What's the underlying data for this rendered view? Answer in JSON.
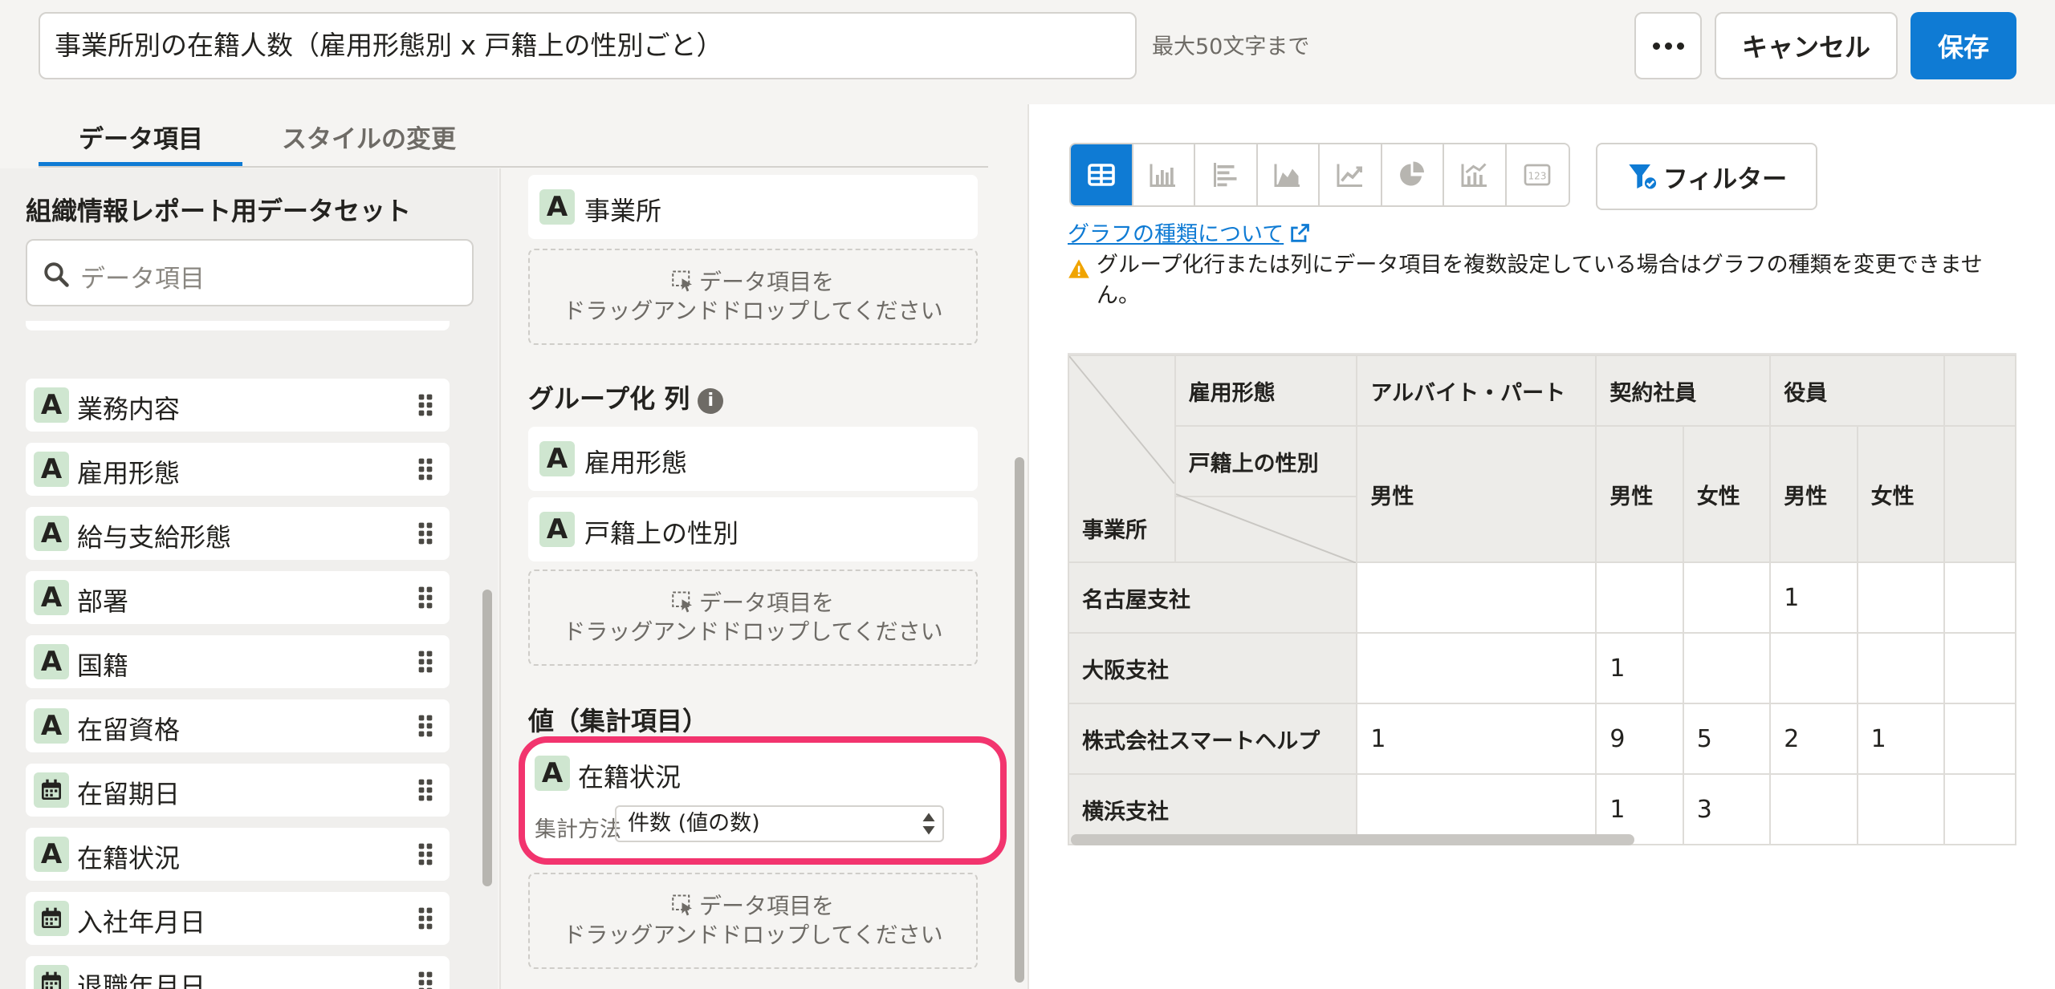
{
  "header": {
    "title_value": "事業所別の在籍人数（雇用形態別 x 戸籍上の性別ごと）",
    "title_hint": "最大50文字まで",
    "more_label": "•••",
    "cancel_label": "キャンセル",
    "save_label": "保存"
  },
  "tabs": [
    {
      "label": "データ項目",
      "active": true
    },
    {
      "label": "スタイルの変更",
      "active": false
    }
  ],
  "dataset": {
    "title": "組織情報レポート用データセット",
    "search_placeholder": "データ項目",
    "fields": [
      {
        "label": "業務内容",
        "type": "text",
        "type_badge": "A"
      },
      {
        "label": "雇用形態",
        "type": "text",
        "type_badge": "A"
      },
      {
        "label": "給与支給形態",
        "type": "text",
        "type_badge": "A"
      },
      {
        "label": "部署",
        "type": "text",
        "type_badge": "A"
      },
      {
        "label": "国籍",
        "type": "text",
        "type_badge": "A"
      },
      {
        "label": "在留資格",
        "type": "text",
        "type_badge": "A"
      },
      {
        "label": "在留期日",
        "type": "date",
        "type_badge": "calendar-icon"
      },
      {
        "label": "在籍状況",
        "type": "text",
        "type_badge": "A"
      },
      {
        "label": "入社年月日",
        "type": "date",
        "type_badge": "calendar-icon"
      },
      {
        "label": "退職年月日",
        "type": "date",
        "type_badge": "calendar-icon"
      }
    ]
  },
  "config": {
    "rows": [
      {
        "label": "事業所",
        "type_badge": "A"
      }
    ],
    "dropzone_line1": "データ項目を",
    "dropzone_line2": "ドラッグアンドドロップしてください",
    "columns_title": "グループ化 列",
    "columns": [
      {
        "label": "雇用形態",
        "type_badge": "A"
      },
      {
        "label": "戸籍上の性別",
        "type_badge": "A"
      }
    ],
    "values_title": "値（集計項目）",
    "value_field": {
      "label": "在籍状況",
      "type_badge": "A"
    },
    "aggregation_label": "集計方法",
    "aggregation_value": "件数 (値の数)"
  },
  "chart": {
    "types": [
      "table-icon",
      "bar-chart-icon",
      "horizontal-bar-icon",
      "area-chart-icon",
      "line-chart-icon",
      "pie-chart-icon",
      "combo-chart-icon",
      "number-icon"
    ],
    "selected_type": "table-icon",
    "filter_label": "フィルター",
    "types_link": "グラフの種類について",
    "warning": "グループ化行または列にデータ項目を複数設定している場合はグラフの種類を変更できません。"
  },
  "pivot": {
    "col_header_1": "雇用形態",
    "col_header_2": "戸籍上の性別",
    "row_header": "事業所",
    "employment_types": [
      "アルバイト・パート",
      "契約社員",
      "役員"
    ],
    "genders": [
      "男性",
      "男性",
      "女性",
      "男性",
      "女性"
    ],
    "rows": [
      {
        "name": "名古屋支社",
        "values": [
          "",
          "",
          "",
          "1",
          ""
        ]
      },
      {
        "name": "大阪支社",
        "values": [
          "",
          "1",
          "",
          "",
          ""
        ]
      },
      {
        "name": "株式会社スマートヘルプ",
        "values": [
          "1",
          "9",
          "5",
          "2",
          "1"
        ]
      },
      {
        "name": "横浜支社",
        "values": [
          "",
          "1",
          "3",
          "",
          ""
        ]
      }
    ]
  },
  "colors": {
    "accent": "#0f7bd4",
    "highlight": "#f2346e",
    "type_badge": "#cfe6d0",
    "warning": "#f0a400"
  }
}
